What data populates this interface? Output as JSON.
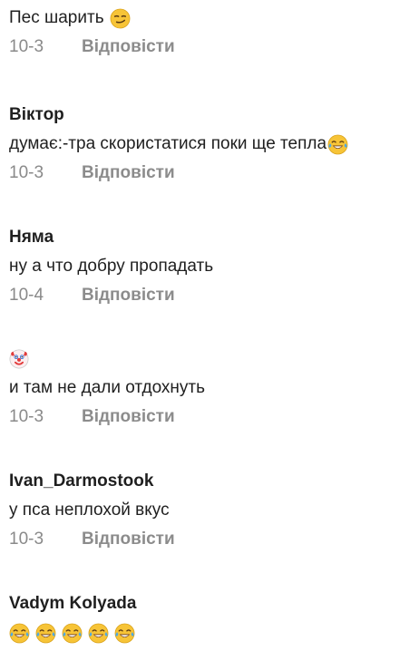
{
  "comments": [
    {
      "author": "",
      "text": "Пес шарить",
      "emoji_icon": "smirk-face-icon",
      "date": "10-3",
      "reply_label": "Відповісти"
    },
    {
      "author": "Віктор",
      "text": "думає:-тра скористатися поки ще тепла",
      "emoji_icon": "tears-of-joy-icon",
      "date": "10-3",
      "reply_label": "Відповісти"
    },
    {
      "author": "Няма",
      "text": "ну а что добру пропадать",
      "date": "10-4",
      "reply_label": "Відповісти"
    },
    {
      "author_icon": "clown-face-icon",
      "text": "и там не дали отдохнуть",
      "date": "10-3",
      "reply_label": "Відповісти"
    },
    {
      "author": "Ivan_Darmostook",
      "text": "у пса неплохой вкус",
      "date": "10-3",
      "reply_label": "Відповісти"
    },
    {
      "author": "Vadym Kolyada",
      "emoji_icons": [
        "tears-of-joy-icon",
        "tears-of-joy-icon",
        "tears-of-joy-icon",
        "tears-of-joy-icon",
        "tears-of-joy-icon"
      ]
    }
  ]
}
